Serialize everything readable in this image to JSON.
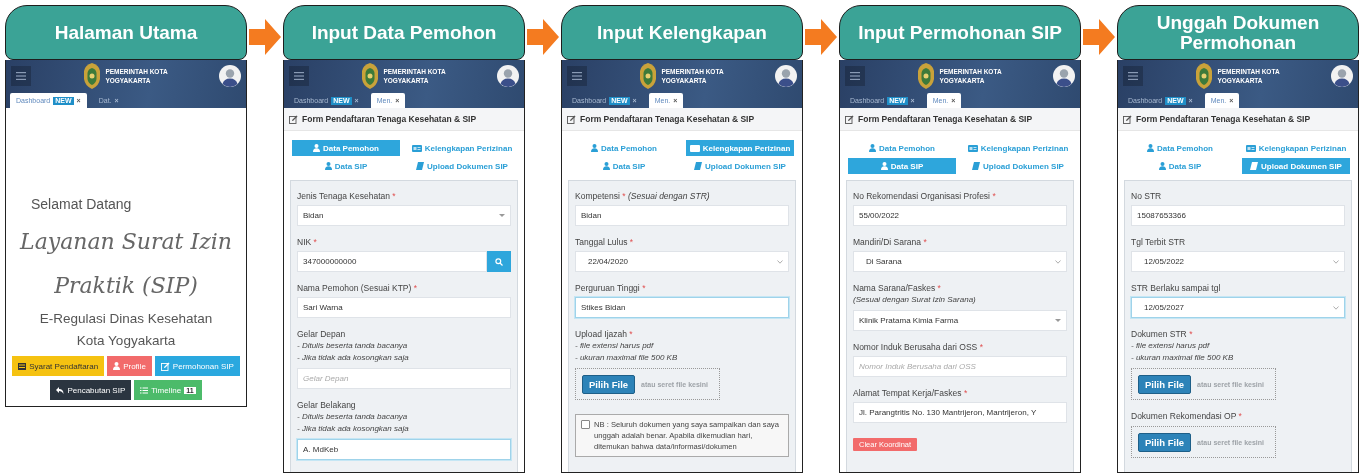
{
  "steps": [
    {
      "title": "Halaman Utama",
      "screen": {
        "header": {
          "org_name_lines": [
            "PEMERINTAH KOTA",
            "YOGYAKARTA"
          ]
        },
        "tabs": [
          {
            "label": "Dashboard",
            "badge": "NEW",
            "close": "×",
            "selected": true
          },
          {
            "label": "Dat.",
            "close": "×",
            "selected": false
          }
        ],
        "content": {
          "kind": "home",
          "greeting": "Selamat Datang",
          "title_lines": [
            "Layanan Surat Izin",
            "Praktik (SIP)"
          ],
          "subtitle_lines": [
            "E-Regulasi Dinas Kesehatan",
            "Kota Yogyakarta"
          ],
          "button_rows": [
            [
              {
                "label": "Syarat Pendaftaran",
                "color": "#f5c211"
              },
              {
                "label": "Profile",
                "color": "#f26b6b"
              },
              {
                "label": "Permohonan SIP",
                "color": "#2aa8df"
              }
            ],
            [
              {
                "label": "Pencabutan SIP",
                "color": "#2b3540"
              },
              {
                "label": "Timeline",
                "badge": "11",
                "color": "#4cbb6a"
              }
            ]
          ]
        }
      }
    },
    {
      "title": "Input Data Pemohon",
      "screen": {
        "header": {
          "org_name_lines": [
            "PEMERINTAH KOTA",
            "YOGYAKARTA"
          ]
        },
        "tabs": [
          {
            "label": "Dashboard",
            "badge": "NEW",
            "close": "×",
            "selected": false
          },
          {
            "label": "Men.",
            "close": "×",
            "selected": true
          }
        ],
        "content": {
          "kind": "form",
          "title": "Form Pendaftaran Tenaga Kesehatan & SIP",
          "sections": [
            {
              "label": "Data Pemohon",
              "selected": true
            },
            {
              "label": "Kelengkapan Perizinan",
              "selected": false
            },
            {
              "label": "Data SIP",
              "selected": false
            },
            {
              "label": "Upload Dokumen SIP",
              "selected": false
            }
          ],
          "fields": [
            {
              "kind": "select",
              "label": "Jenis Tenaga Kesehatan",
              "mark": "*",
              "value": "Bidan",
              "focused": false
            },
            {
              "kind": "search",
              "label": "NIK",
              "mark": "*",
              "value": "347000000000",
              "focused": false
            },
            {
              "kind": "text",
              "label": "Nama Pemohon (Sesuai KTP)",
              "mark": "*",
              "value": "Sari Warna",
              "focused": false
            },
            {
              "kind": "text",
              "label": "Gelar Depan",
              "hints": [
                "- Ditulis beserta tanda bacanya",
                "- Jika tidak ada kosongkan saja"
              ],
              "placeholder": "Gelar Depan",
              "focused": false
            },
            {
              "kind": "text",
              "label": "Gelar Belakang",
              "hints": [
                "- Ditulis beserta tanda bacanya",
                "- Jika tidak ada kosongkan saja"
              ],
              "value": "A. MdKeb",
              "focused": true
            }
          ]
        }
      }
    },
    {
      "title": "Input Kelengkapan",
      "screen": {
        "header": {
          "org_name_lines": [
            "PEMERINTAH KOTA",
            "YOGYAKARTA"
          ]
        },
        "tabs": [
          {
            "label": "Dashboard",
            "badge": "NEW",
            "close": "×",
            "selected": false
          },
          {
            "label": "Men.",
            "close": "×",
            "selected": true
          }
        ],
        "content": {
          "kind": "form",
          "title": "Form Pendaftaran Tenaga Kesehatan & SIP",
          "sections": [
            {
              "label": "Data Pemohon",
              "selected": false
            },
            {
              "label": "Kelengkapan Perizinan",
              "selected": true
            },
            {
              "label": "Data SIP",
              "selected": false
            },
            {
              "label": "Upload Dokumen SIP",
              "selected": false
            }
          ],
          "fields": [
            {
              "kind": "text",
              "label": "Kompetensi",
              "mark": "*",
              "note": "(Sesuai dengan STR)",
              "value": "Bidan",
              "focused": false
            },
            {
              "kind": "date",
              "label": "Tanggal Lulus",
              "mark": "*",
              "value": "22/04/2020",
              "focused": false
            },
            {
              "kind": "text",
              "label": "Perguruan Tinggi",
              "mark": "*",
              "value": "Stikes Bidan",
              "focused": true
            },
            {
              "kind": "file",
              "label": "Upload Ijazah",
              "mark": "*",
              "hints": [
                "- file extensi harus pdf",
                "- ukuran maximal file 500 KB"
              ],
              "button": "Pilih File",
              "drop_hint": "atau seret file kesini"
            },
            {
              "kind": "agreement",
              "checked": false,
              "text": "NB : Seluruh dokumen yang saya sampaikan dan saya unggah adalah benar. Apabila dikemudian hari, ditemukan bahwa data/informasi/dokumen"
            }
          ]
        }
      }
    },
    {
      "title": "Input Permohonan SIP",
      "screen": {
        "header": {
          "org_name_lines": [
            "PEMERINTAH KOTA",
            "YOGYAKARTA"
          ]
        },
        "tabs": [
          {
            "label": "Dashboard",
            "badge": "NEW",
            "close": "×",
            "selected": false
          },
          {
            "label": "Men.",
            "close": "×",
            "selected": true
          }
        ],
        "content": {
          "kind": "form",
          "title": "Form Pendaftaran Tenaga Kesehatan & SIP",
          "sections": [
            {
              "label": "Data Pemohon",
              "selected": false
            },
            {
              "label": "Kelengkapan Perizinan",
              "selected": false
            },
            {
              "label": "Data SIP",
              "selected": true
            },
            {
              "label": "Upload Dokumen SIP",
              "selected": false
            }
          ],
          "fields": [
            {
              "kind": "text",
              "label": "No Rekomendasi Organisasi Profesi",
              "mark": "*",
              "value": "55/00/2022",
              "focused": false
            },
            {
              "kind": "date",
              "label": "Mandiri/Di Sarana",
              "mark": "*",
              "value": "Di Sarana",
              "focused": false
            },
            {
              "kind": "select",
              "label": "Nama Sarana/Faskes",
              "mark": "*",
              "hints": [
                "(Sesuai dengan Surat Izin Sarana)"
              ],
              "value": "Klinik Pratama Kimia Farma",
              "focused": false
            },
            {
              "kind": "text",
              "label": "Nomor Induk Berusaha dari OSS",
              "mark": "*",
              "placeholder": "Nomor Induk Berusaha dari OSS",
              "focused": false
            },
            {
              "kind": "text",
              "label": "Alamat Tempat Kerja/Faskes",
              "mark": "*",
              "value": "Jl. Parangtritis No. 130 Mantrijeron, Mantrijeron, Y",
              "focused": false
            },
            {
              "kind": "action",
              "label": "Clear Koordinat",
              "color": "#f26b6b"
            }
          ]
        }
      }
    },
    {
      "title": "Unggah Dokumen Permohonan",
      "screen": {
        "header": {
          "org_name_lines": [
            "PEMERINTAH KOTA",
            "YOGYAKARTA"
          ]
        },
        "tabs": [
          {
            "label": "Dashboard",
            "badge": "NEW",
            "close": "×",
            "selected": false
          },
          {
            "label": "Men.",
            "close": "×",
            "selected": true
          }
        ],
        "content": {
          "kind": "form",
          "title": "Form Pendaftaran Tenaga Kesehatan & SIP",
          "sections": [
            {
              "label": "Data Pemohon",
              "selected": false
            },
            {
              "label": "Kelengkapan Perizinan",
              "selected": false
            },
            {
              "label": "Data SIP",
              "selected": false
            },
            {
              "label": "Upload Dokumen SIP",
              "selected": true
            }
          ],
          "fields": [
            {
              "kind": "text",
              "label": "No STR",
              "value": "15087653366",
              "focused": false
            },
            {
              "kind": "date",
              "label": "Tgl Terbit STR",
              "value": "12/05/2022",
              "focused": false
            },
            {
              "kind": "date",
              "label": "STR Berlaku sampai tgl",
              "value": "12/05/2027",
              "focused": true
            },
            {
              "kind": "file",
              "label": "Dokumen STR",
              "mark": "*",
              "hints": [
                "- file extensi harus pdf",
                "- ukuran maximal file 500 KB"
              ],
              "button": "Pilih File",
              "drop_hint": "atau seret file kesini"
            },
            {
              "kind": "file",
              "label": "Dokumen Rekomendasi OP",
              "mark": "*",
              "button": "Pilih File",
              "drop_hint": "atau seret file kesini"
            }
          ]
        }
      }
    }
  ]
}
